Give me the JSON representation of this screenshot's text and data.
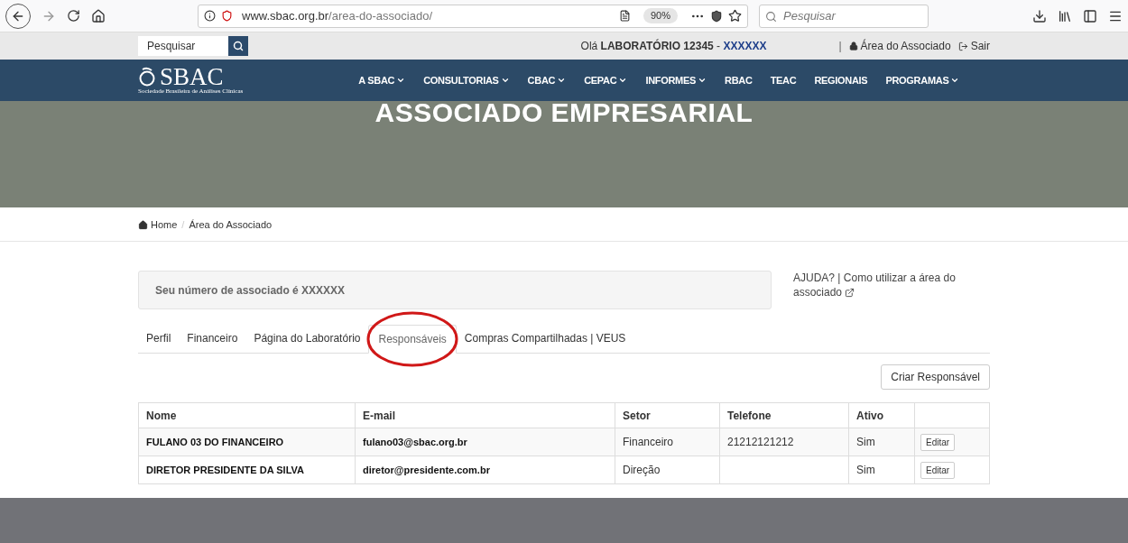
{
  "browser": {
    "url_domain": "www.sbac.org.br",
    "url_path": "/area-do-associado/",
    "zoom": "90%",
    "search_placeholder": "Pesquisar"
  },
  "topbar": {
    "search_placeholder": "Pesquisar",
    "greeting": "Olá",
    "lab_name": "LABORATÓRIO 12345",
    "dash": "-",
    "lab_code": "XXXXXX",
    "separator": "|",
    "member_area": "Área do Associado",
    "logout": "Sair"
  },
  "nav": {
    "logo": "SBAC",
    "logo_subtitle": "Sociedade Brasileira de Análises Clínicas",
    "items": [
      {
        "label": "A SBAC",
        "dropdown": true
      },
      {
        "label": "CONSULTORIAS",
        "dropdown": true
      },
      {
        "label": "CBAC",
        "dropdown": true
      },
      {
        "label": "CEPAC",
        "dropdown": true
      },
      {
        "label": "INFORMES",
        "dropdown": true
      },
      {
        "label": "RBAC",
        "dropdown": false
      },
      {
        "label": "TEAC",
        "dropdown": false
      },
      {
        "label": "REGIONAIS",
        "dropdown": false
      },
      {
        "label": "PROGRAMAS",
        "dropdown": true
      }
    ]
  },
  "hero": {
    "title": "ASSOCIADO EMPRESARIAL"
  },
  "breadcrumb": {
    "separator": "/",
    "items": [
      "Home",
      "Área do Associado"
    ]
  },
  "member_notice": "Seu número de associado é XXXXXX",
  "help": {
    "prefix": "AJUDA? |",
    "link": "Como utilizar a área do associado"
  },
  "tabs": [
    {
      "label": "Perfil",
      "selected": false
    },
    {
      "label": "Financeiro",
      "selected": false
    },
    {
      "label": "Página do Laboratório",
      "selected": false
    },
    {
      "label": "Responsáveis",
      "selected": true
    },
    {
      "label": "Compras Compartilhadas | VEUS",
      "selected": false
    }
  ],
  "create_button": "Criar Responsável",
  "table": {
    "columns": [
      "Nome",
      "E-mail",
      "Setor",
      "Telefone",
      "Ativo"
    ],
    "rows": [
      {
        "nome": "FULANO 03 DO FINANCEIRO",
        "email": "fulano03@sbac.org.br",
        "setor": "Financeiro",
        "telefone": "21212121212",
        "ativo": "Sim",
        "action": "Editar"
      },
      {
        "nome": "DIRETOR PRESIDENTE DA SILVA",
        "email": "diretor@presidente.com.br",
        "setor": "Direção",
        "telefone": "",
        "ativo": "Sim",
        "action": "Editar"
      }
    ]
  }
}
